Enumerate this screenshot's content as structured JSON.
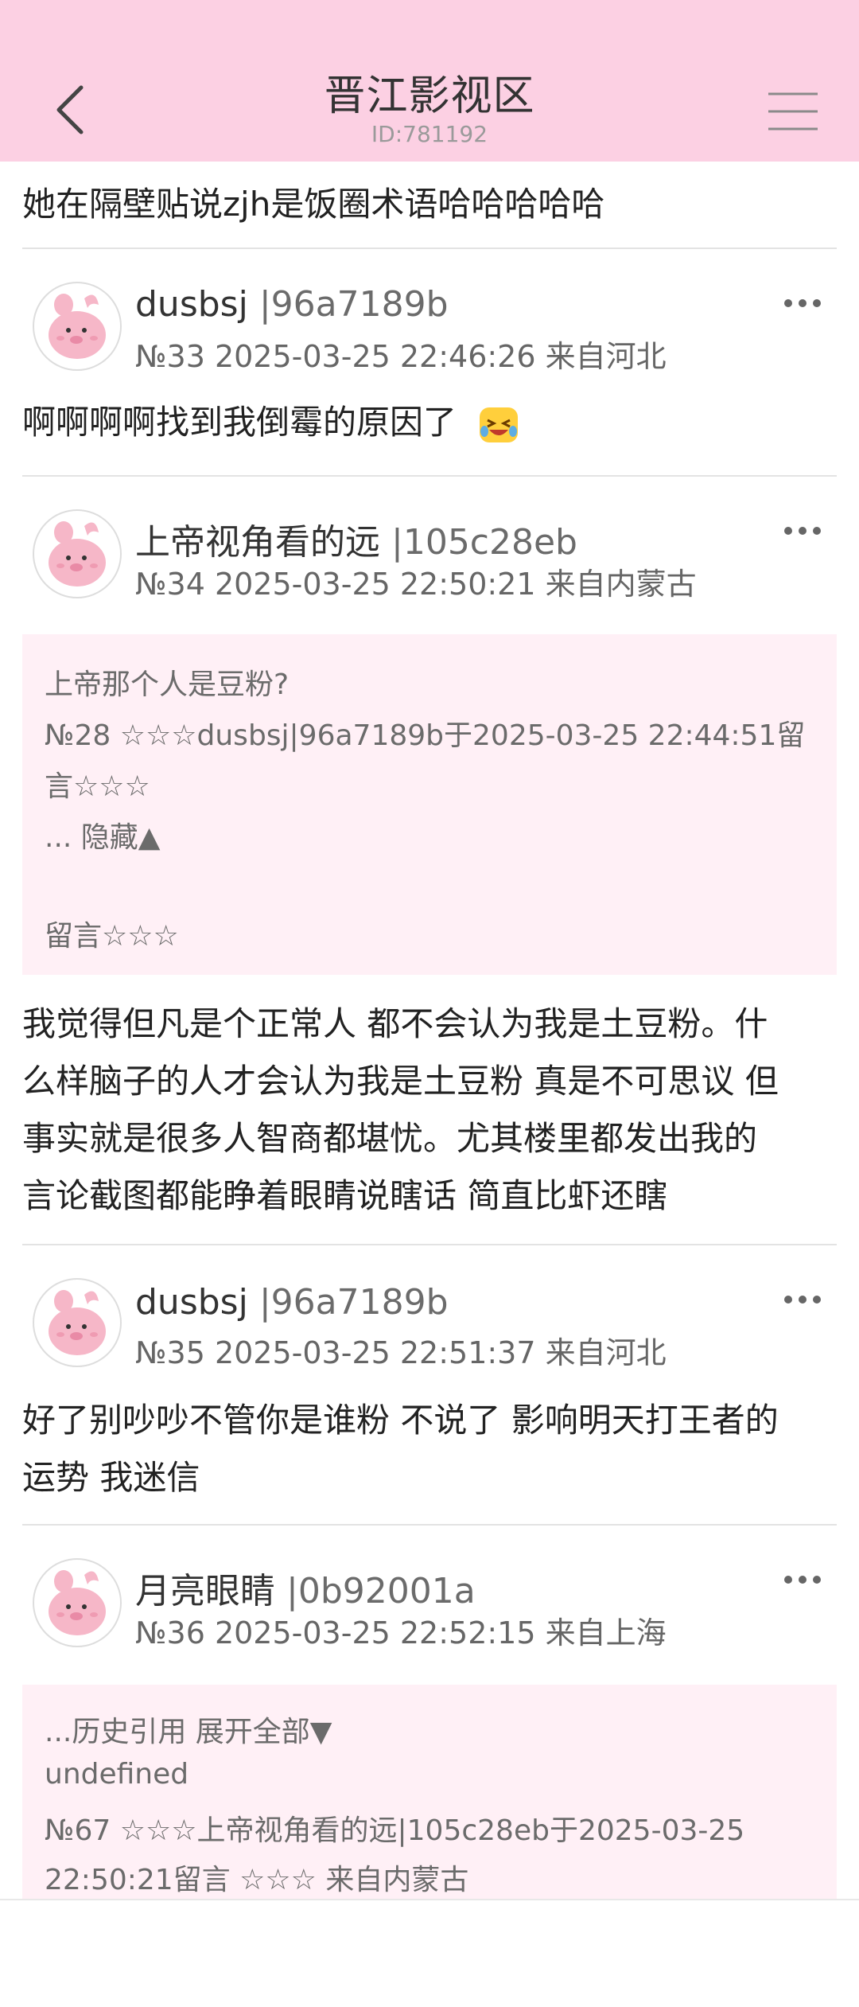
{
  "header": {
    "title": "晋江影视区",
    "subtitle": "ID:781192"
  },
  "top_text": "她在隔壁贴说zjh是饭圈术语哈哈哈哈哈",
  "posts": [
    {
      "username": "dusbsj",
      "user_id": "|96a7189b",
      "meta": "№33 2025-03-25 22:46:26 来自河北",
      "body": "啊啊啊啊找到我倒霉的原因了"
    },
    {
      "username": "上帝视角看的远",
      "user_id": "|105c28eb",
      "meta": "№34 2025-03-25 22:50:21 来自内蒙古",
      "quote": {
        "line1": "上帝那个人是豆粉?",
        "line2": "№28 ☆☆☆dusbsj|96a7189b于2025-03-25 22:44:51留",
        "line3": "言☆☆☆",
        "line4": "... 隐藏▲",
        "line5": "留言☆☆☆"
      },
      "body_lines": [
        "我觉得但凡是个正常人 都不会认为我是土豆粉。什",
        "么样脑子的人才会认为我是土豆粉 真是不可思议 但",
        "事实就是很多人智商都堪忧。尤其楼里都发出我的",
        "言论截图都能睁着眼睛说瞎话 简直比虾还瞎"
      ]
    },
    {
      "username": "dusbsj",
      "user_id": "|96a7189b",
      "meta": "№35 2025-03-25 22:51:37 来自河北",
      "body_lines": [
        "好了别吵吵不管你是谁粉 不说了 影响明天打王者的",
        "运势 我迷信"
      ]
    },
    {
      "username": "月亮眼睛",
      "user_id": "|0b92001a",
      "meta": "№36 2025-03-25 22:52:15 来自上海",
      "quote": {
        "line1": "...历史引用 展开全部▼",
        "line2": "undefined",
        "line3": "№67 ☆☆☆上帝视角看的远|105c28eb于2025-03-25",
        "line4": "22:50:21留言 ☆☆☆    来自内蒙古"
      }
    }
  ],
  "icons": {
    "back": "chevron-left-icon",
    "menu": "hamburger-menu-icon",
    "more": "more-dots-icon",
    "avatar": "pink-pig-avatar",
    "emoji": "laughing-tears-emoji"
  },
  "colors": {
    "header_bg": "#fcd0e3",
    "quote_bg": "#fff0f6",
    "divider": "#e3e3e3"
  }
}
